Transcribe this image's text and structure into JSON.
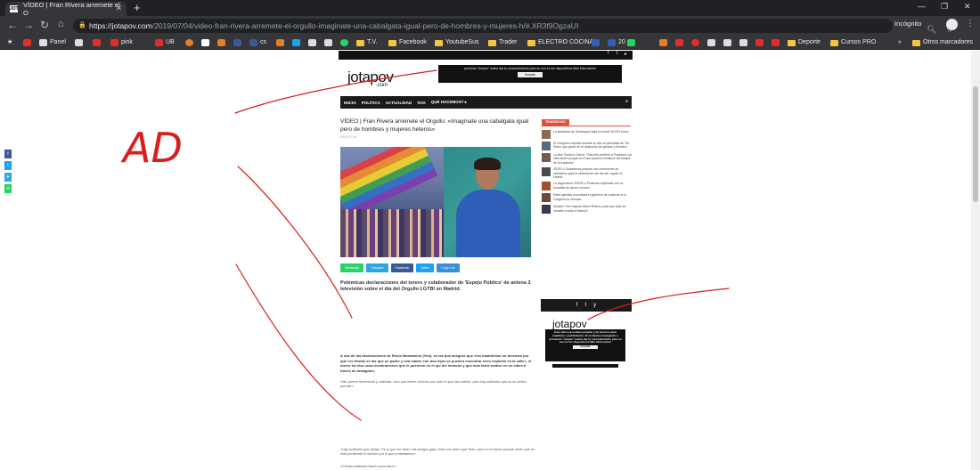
{
  "browser": {
    "tab_title": "VÍDEO | Fran Rivera arremete el O",
    "tab_favicon": "JOT",
    "new_tab": "+",
    "url_host": "https://jotapov.com",
    "url_path": "/2019/07/04/video-fran-rivera-arremete-el-orgullo-imaginate-una-cabalgata-igual-pero-de-hombres-y-mujeres-h/#.XR3f9OgzaUI",
    "incognito_label": "Incógnito",
    "bookmarks": [
      "Panel",
      "pink",
      "UB",
      "cs",
      "T.V.",
      "Facebook",
      "YoutubeSus",
      "Trader",
      "ELECTRO COCINA",
      "20",
      "Deporte",
      "Cursos PRO",
      "Otros marcadores"
    ],
    "more_bookmarks": "»"
  },
  "site": {
    "logo": "jotapov",
    "logo_suffix": ".com",
    "nav": [
      "INICIO",
      "POLÍTICA",
      "ACTUALIDAD",
      "VOX",
      "QUÉ HACEMOS? ▸"
    ],
    "cookie_top": "presiona \"Acepto\" indica dar tu consentimiento para su uso en los dispositivos Más información",
    "cookie_top_ok": "Aceptar"
  },
  "article": {
    "title": "VÍDEO | Fran Rivera arremete el Orgullo: «Imagínate una cabalgata igual pero de hombres y mujeres heteros»",
    "date": "2019-07-04",
    "share_buttons": [
      {
        "label": "WhatsApp",
        "color": "#25d366"
      },
      {
        "label": "Telegram",
        "color": "#2ca5e0"
      },
      {
        "label": "Facebook",
        "color": "#3b5998"
      },
      {
        "label": "Twitter",
        "color": "#1da1f2"
      },
      {
        "label": "Copy Link",
        "color": "#3a8fd8"
      }
    ],
    "subtitle": "Polémicas declaraciones del torero y colaborador de 'Espejo Público' de antena 3 televisión sobre el día del Orgullo LGTBI en Madrid.",
    "para1": "A raíz de las declaraciones de Rocío Monasterio (Vox), en las que aseguró que «los madrileños no tenemos por qué ver fiestas en las que un padre y una madre con dos hijos se pueden encontrar sexo explícito en la calle», el torero ha hizo unas declaraciones que le pusieron en el ojo del huracán y que más tarde matizó en un vídeo a través de Instagram.",
    "para2": "«Me parece fenómenal y, además, creo que tienen derecho por todo lo que han sufrido, pero hay actitudes que no se deben permitir».",
    "para3": "«Hay actitudes que dañan. Es lo que me dicen mis amigos gays. Ellos me dicen que l'Han, pero no lo hacen porque creen que se está perdiendo el sentido por el que protestamos».",
    "para4": "«Ciertas actitudes hacen poco favor»"
  },
  "sidebar": {
    "heading": "TENDENCIAS",
    "items": [
      "La alcaldesa de Ouarengue baja el sueldo 26.000 euros",
      "El Congreso expulsa durante un año al periodista de 'OK Diario' que grabó en el despacho de Iglesias y Montero",
      "La dice Teodoro García: \"Sánchez prefiere a Podemos con elecciones porque es el que pacta la rendición del bloque de la izquierda\"",
      "VÍDEO | Ciudadanos prepara otro incremento de victimismo para la celebración del día del orgullo en Madrid",
      "La negociación PSOE-U Podemos explicada con un bocadillo de jamón serrano",
      "Pablo Iglesias renunciará el gobierno de coalición si el Congreso lo rechaza",
      "Montero 'Ves Inquisa' Albert Rivera y pide que deje de 'remarle el auto a Macron'"
    ],
    "social": [
      "f",
      "t",
      "y"
    ],
    "logo2": "jotapov",
    "cookie_side": "Este sitio usa cookies propias y de terceros para analíticas o publicitarias. Si continúas navegando o presionas \"Acepto\" indica dar tu consentimiento para su uso en los dispositivos Más información",
    "cookie_side_ok": "Aceptar"
  },
  "float_share": [
    {
      "icon": "f",
      "color": "#3b5998"
    },
    {
      "icon": "t",
      "color": "#1da1f2"
    },
    {
      "icon": "➤",
      "color": "#2ca5e0"
    },
    {
      "icon": "w",
      "color": "#25d366"
    }
  ],
  "annotation": {
    "text": "AD",
    "color": "#d81e1e"
  }
}
